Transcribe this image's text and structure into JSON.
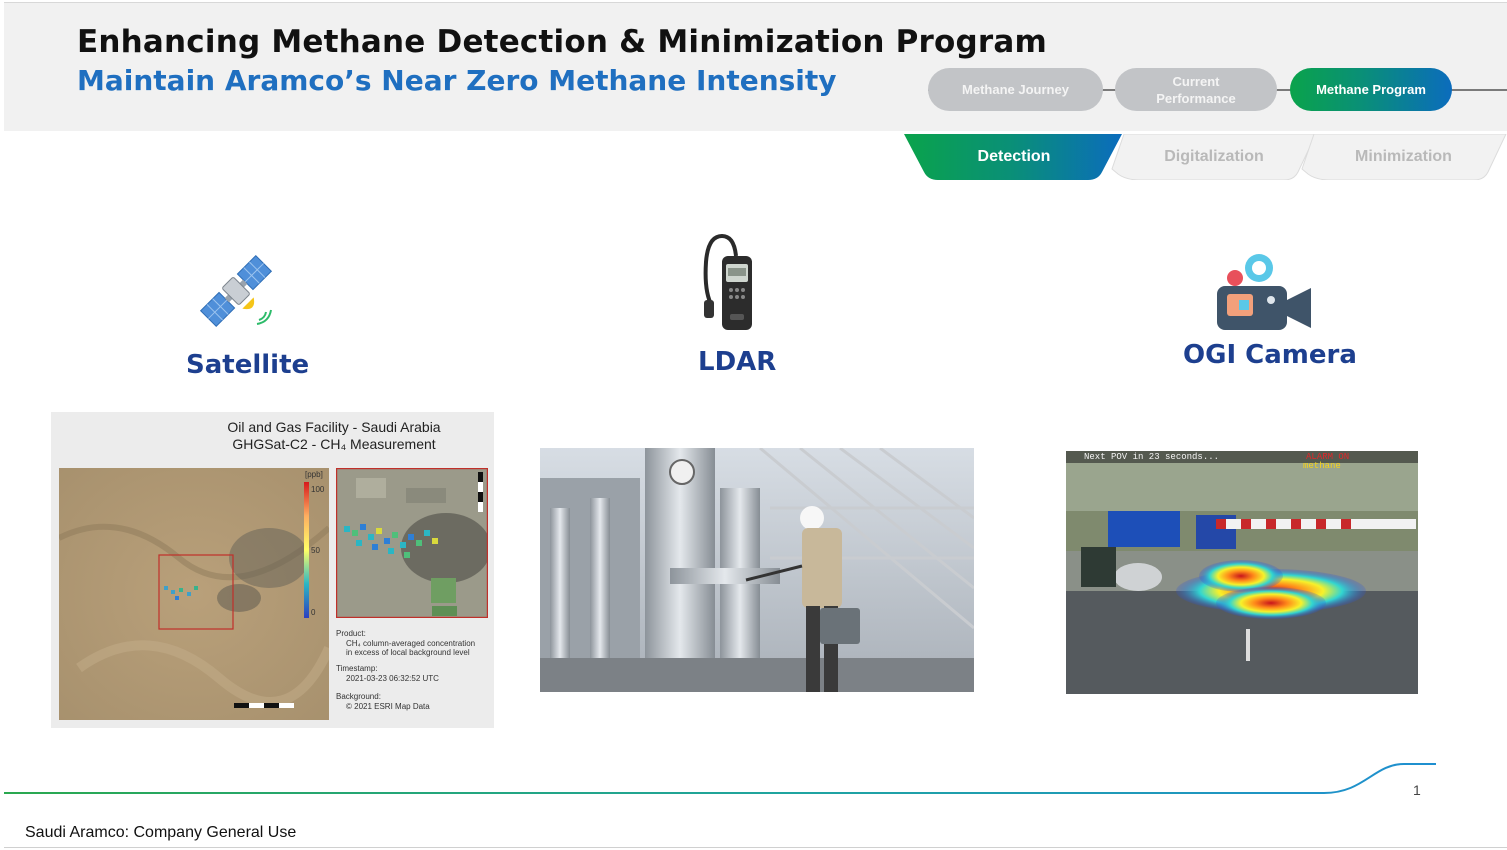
{
  "header": {
    "title": "Enhancing Methane Detection & Minimization Program",
    "subtitle": "Maintain Aramco’s Near Zero Methane Intensity"
  },
  "nav": {
    "pills": [
      {
        "label": "Methane Journey",
        "active": false
      },
      {
        "label": "Current Performance",
        "active": false
      },
      {
        "label": "Methane Program",
        "active": true
      }
    ],
    "tabs": [
      {
        "label": "Detection",
        "active": true
      },
      {
        "label": "Digitalization",
        "active": false
      },
      {
        "label": "Minimization",
        "active": false
      }
    ]
  },
  "columns": [
    {
      "label": "Satellite",
      "icon": "satellite-icon"
    },
    {
      "label": "LDAR",
      "icon": "gas-detector-icon"
    },
    {
      "label": "OGI Camera",
      "icon": "video-camera-icon"
    }
  ],
  "satellite_panel": {
    "title_line1": "Oil and Gas Facility - Saudi Arabia",
    "title_line2": "GHGSat-C2 - CH₄ Measurement",
    "scale_unit": "[ppb]",
    "scale_ticks": [
      "100",
      "50",
      "0"
    ],
    "product_label": "Product:",
    "product_line1": "CH₄ column-averaged concentration",
    "product_line2": "in excess of local background level",
    "timestamp_label": "Timestamp:",
    "timestamp_value": "2021-03-23 06:32:52 UTC",
    "background_label": "Background:",
    "background_value": "© 2021 ESRI Map Data"
  },
  "ogi_panel": {
    "overlay_left": "Next POV in 23 seconds...",
    "overlay_right_top": "ALARM ON",
    "overlay_right_bottom": "methane"
  },
  "footer": {
    "page_number": "1",
    "classification": "Saudi Aramco: Company General Use"
  },
  "colors": {
    "title": "#111111",
    "subtitle": "#1f6fc0",
    "column_label": "#1d3f8f",
    "pill_inactive": "#c2c4c7",
    "gradient_green": "#0aa34b",
    "gradient_blue": "#0b6cbd"
  }
}
